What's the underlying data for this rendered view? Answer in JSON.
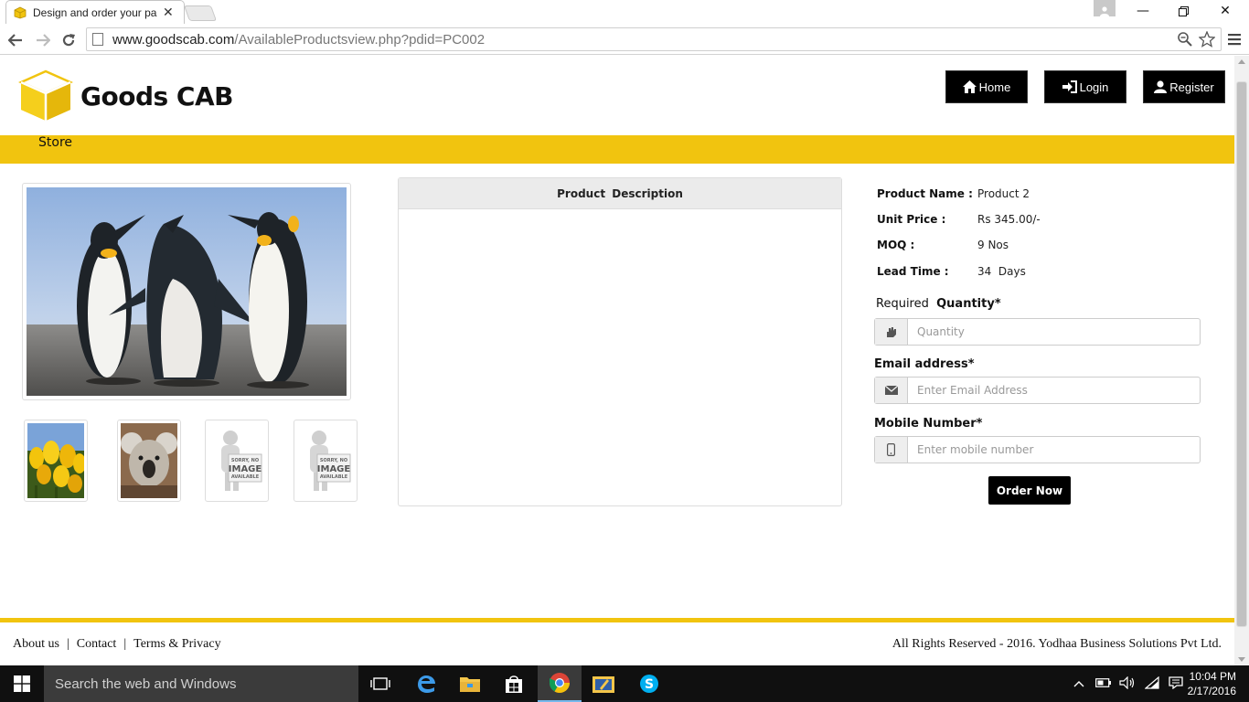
{
  "browser": {
    "tab_title": "Design and order your pa",
    "url_host": "www.goodscab.com",
    "url_path": "/AvailableProductsview.php?pdid=PC002"
  },
  "site": {
    "logo_text": "Goods CAB",
    "nav": {
      "home": "Home",
      "login": "Login",
      "register": "Register"
    },
    "menu": {
      "store": "Store"
    }
  },
  "product": {
    "description_header": "Product Description",
    "name_label": "Product Name :",
    "name_value": "Product 2",
    "price_label": "Unit Price :",
    "price_value": "Rs 345.00/-",
    "moq_label": "MOQ :",
    "moq_value": "9 Nos",
    "lead_label": "Lead Time :",
    "lead_value": "34  Days"
  },
  "form": {
    "quantity_label_prefix": "Required",
    "quantity_label": "Quantity*",
    "quantity_placeholder": "Quantity",
    "email_label": "Email address*",
    "email_placeholder": "Enter Email Address",
    "mobile_label": "Mobile Number*",
    "mobile_placeholder": "Enter mobile number",
    "submit": "Order Now"
  },
  "thumbnails": {
    "no_image_line1": "SORRY, NO",
    "no_image_line2": "IMAGE",
    "no_image_line3": "AVAILABLE"
  },
  "footer": {
    "about": "About us",
    "contact": "Contact",
    "terms": "Terms & Privacy",
    "sep": "|",
    "copyright": "All Rights Reserved - 2016. Yodhaa Business Solutions Pvt Ltd."
  },
  "taskbar": {
    "search_placeholder": "Search the web and Windows",
    "time": "10:04 PM",
    "date": "2/17/2016"
  }
}
